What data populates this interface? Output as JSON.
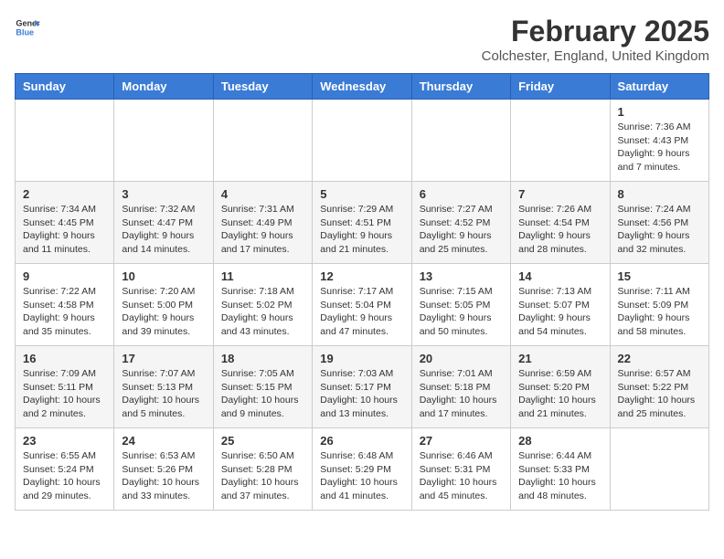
{
  "logo": {
    "text_general": "General",
    "text_blue": "Blue"
  },
  "title": "February 2025",
  "subtitle": "Colchester, England, United Kingdom",
  "days_of_week": [
    "Sunday",
    "Monday",
    "Tuesday",
    "Wednesday",
    "Thursday",
    "Friday",
    "Saturday"
  ],
  "weeks": [
    [
      {
        "day": "",
        "info": ""
      },
      {
        "day": "",
        "info": ""
      },
      {
        "day": "",
        "info": ""
      },
      {
        "day": "",
        "info": ""
      },
      {
        "day": "",
        "info": ""
      },
      {
        "day": "",
        "info": ""
      },
      {
        "day": "1",
        "info": "Sunrise: 7:36 AM\nSunset: 4:43 PM\nDaylight: 9 hours and 7 minutes."
      }
    ],
    [
      {
        "day": "2",
        "info": "Sunrise: 7:34 AM\nSunset: 4:45 PM\nDaylight: 9 hours and 11 minutes."
      },
      {
        "day": "3",
        "info": "Sunrise: 7:32 AM\nSunset: 4:47 PM\nDaylight: 9 hours and 14 minutes."
      },
      {
        "day": "4",
        "info": "Sunrise: 7:31 AM\nSunset: 4:49 PM\nDaylight: 9 hours and 17 minutes."
      },
      {
        "day": "5",
        "info": "Sunrise: 7:29 AM\nSunset: 4:51 PM\nDaylight: 9 hours and 21 minutes."
      },
      {
        "day": "6",
        "info": "Sunrise: 7:27 AM\nSunset: 4:52 PM\nDaylight: 9 hours and 25 minutes."
      },
      {
        "day": "7",
        "info": "Sunrise: 7:26 AM\nSunset: 4:54 PM\nDaylight: 9 hours and 28 minutes."
      },
      {
        "day": "8",
        "info": "Sunrise: 7:24 AM\nSunset: 4:56 PM\nDaylight: 9 hours and 32 minutes."
      }
    ],
    [
      {
        "day": "9",
        "info": "Sunrise: 7:22 AM\nSunset: 4:58 PM\nDaylight: 9 hours and 35 minutes."
      },
      {
        "day": "10",
        "info": "Sunrise: 7:20 AM\nSunset: 5:00 PM\nDaylight: 9 hours and 39 minutes."
      },
      {
        "day": "11",
        "info": "Sunrise: 7:18 AM\nSunset: 5:02 PM\nDaylight: 9 hours and 43 minutes."
      },
      {
        "day": "12",
        "info": "Sunrise: 7:17 AM\nSunset: 5:04 PM\nDaylight: 9 hours and 47 minutes."
      },
      {
        "day": "13",
        "info": "Sunrise: 7:15 AM\nSunset: 5:05 PM\nDaylight: 9 hours and 50 minutes."
      },
      {
        "day": "14",
        "info": "Sunrise: 7:13 AM\nSunset: 5:07 PM\nDaylight: 9 hours and 54 minutes."
      },
      {
        "day": "15",
        "info": "Sunrise: 7:11 AM\nSunset: 5:09 PM\nDaylight: 9 hours and 58 minutes."
      }
    ],
    [
      {
        "day": "16",
        "info": "Sunrise: 7:09 AM\nSunset: 5:11 PM\nDaylight: 10 hours and 2 minutes."
      },
      {
        "day": "17",
        "info": "Sunrise: 7:07 AM\nSunset: 5:13 PM\nDaylight: 10 hours and 5 minutes."
      },
      {
        "day": "18",
        "info": "Sunrise: 7:05 AM\nSunset: 5:15 PM\nDaylight: 10 hours and 9 minutes."
      },
      {
        "day": "19",
        "info": "Sunrise: 7:03 AM\nSunset: 5:17 PM\nDaylight: 10 hours and 13 minutes."
      },
      {
        "day": "20",
        "info": "Sunrise: 7:01 AM\nSunset: 5:18 PM\nDaylight: 10 hours and 17 minutes."
      },
      {
        "day": "21",
        "info": "Sunrise: 6:59 AM\nSunset: 5:20 PM\nDaylight: 10 hours and 21 minutes."
      },
      {
        "day": "22",
        "info": "Sunrise: 6:57 AM\nSunset: 5:22 PM\nDaylight: 10 hours and 25 minutes."
      }
    ],
    [
      {
        "day": "23",
        "info": "Sunrise: 6:55 AM\nSunset: 5:24 PM\nDaylight: 10 hours and 29 minutes."
      },
      {
        "day": "24",
        "info": "Sunrise: 6:53 AM\nSunset: 5:26 PM\nDaylight: 10 hours and 33 minutes."
      },
      {
        "day": "25",
        "info": "Sunrise: 6:50 AM\nSunset: 5:28 PM\nDaylight: 10 hours and 37 minutes."
      },
      {
        "day": "26",
        "info": "Sunrise: 6:48 AM\nSunset: 5:29 PM\nDaylight: 10 hours and 41 minutes."
      },
      {
        "day": "27",
        "info": "Sunrise: 6:46 AM\nSunset: 5:31 PM\nDaylight: 10 hours and 45 minutes."
      },
      {
        "day": "28",
        "info": "Sunrise: 6:44 AM\nSunset: 5:33 PM\nDaylight: 10 hours and 48 minutes."
      },
      {
        "day": "",
        "info": ""
      }
    ]
  ]
}
